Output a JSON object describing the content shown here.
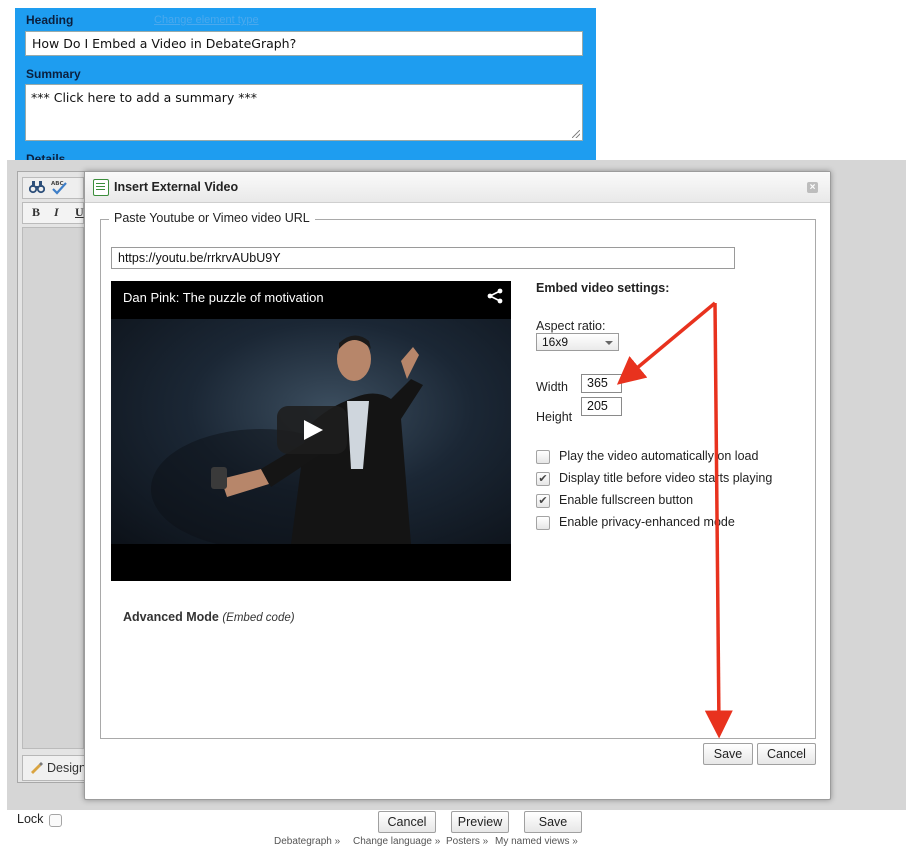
{
  "form": {
    "heading_label": "Heading",
    "change_link": "Change element type",
    "heading_value": "How Do I Embed a Video in DebateGraph?",
    "summary_label": "Summary",
    "summary_value": "*** Click here to add a summary ***",
    "details_label": "Details"
  },
  "editor": {
    "bold": "B",
    "italic": "I",
    "underline": "U",
    "design_tab": "Design"
  },
  "dialog": {
    "title": "Insert External Video",
    "legend": "Paste Youtube or Vimeo video URL",
    "url_value": "https://youtu.be/rrkrvAUbU9Y",
    "video_title": "Dan Pink: The puzzle of motivation",
    "settings_title": "Embed video settings:",
    "aspect_label": "Aspect ratio:",
    "aspect_value": "16x9",
    "width_label": "Width",
    "width_value": "365",
    "height_label": "Height",
    "height_value": "205",
    "options": [
      {
        "label": "Play the video automatically on load",
        "checked": false
      },
      {
        "label": "Display title before video starts playing",
        "checked": true
      },
      {
        "label": "Enable fullscreen button",
        "checked": true
      },
      {
        "label": "Enable privacy-enhanced mode",
        "checked": false
      }
    ],
    "advanced_label": "Advanced Mode",
    "advanced_hint": "(Embed code)",
    "save_label": "Save",
    "cancel_label": "Cancel"
  },
  "bottom": {
    "lock_label": "Lock",
    "cancel_label": "Cancel",
    "preview_label": "Preview",
    "save_label": "Save"
  },
  "footer": {
    "links": [
      "Debategraph »",
      "Change language »",
      "Posters »",
      "My named views »"
    ]
  },
  "colors": {
    "form_panel": "#1e9df0",
    "annotation_arrow": "#e8321e"
  },
  "icons": [
    "find-icon",
    "spellcheck-icon",
    "dialog-video-icon",
    "close-icon",
    "share-icon",
    "play-icon",
    "design-icon"
  ]
}
